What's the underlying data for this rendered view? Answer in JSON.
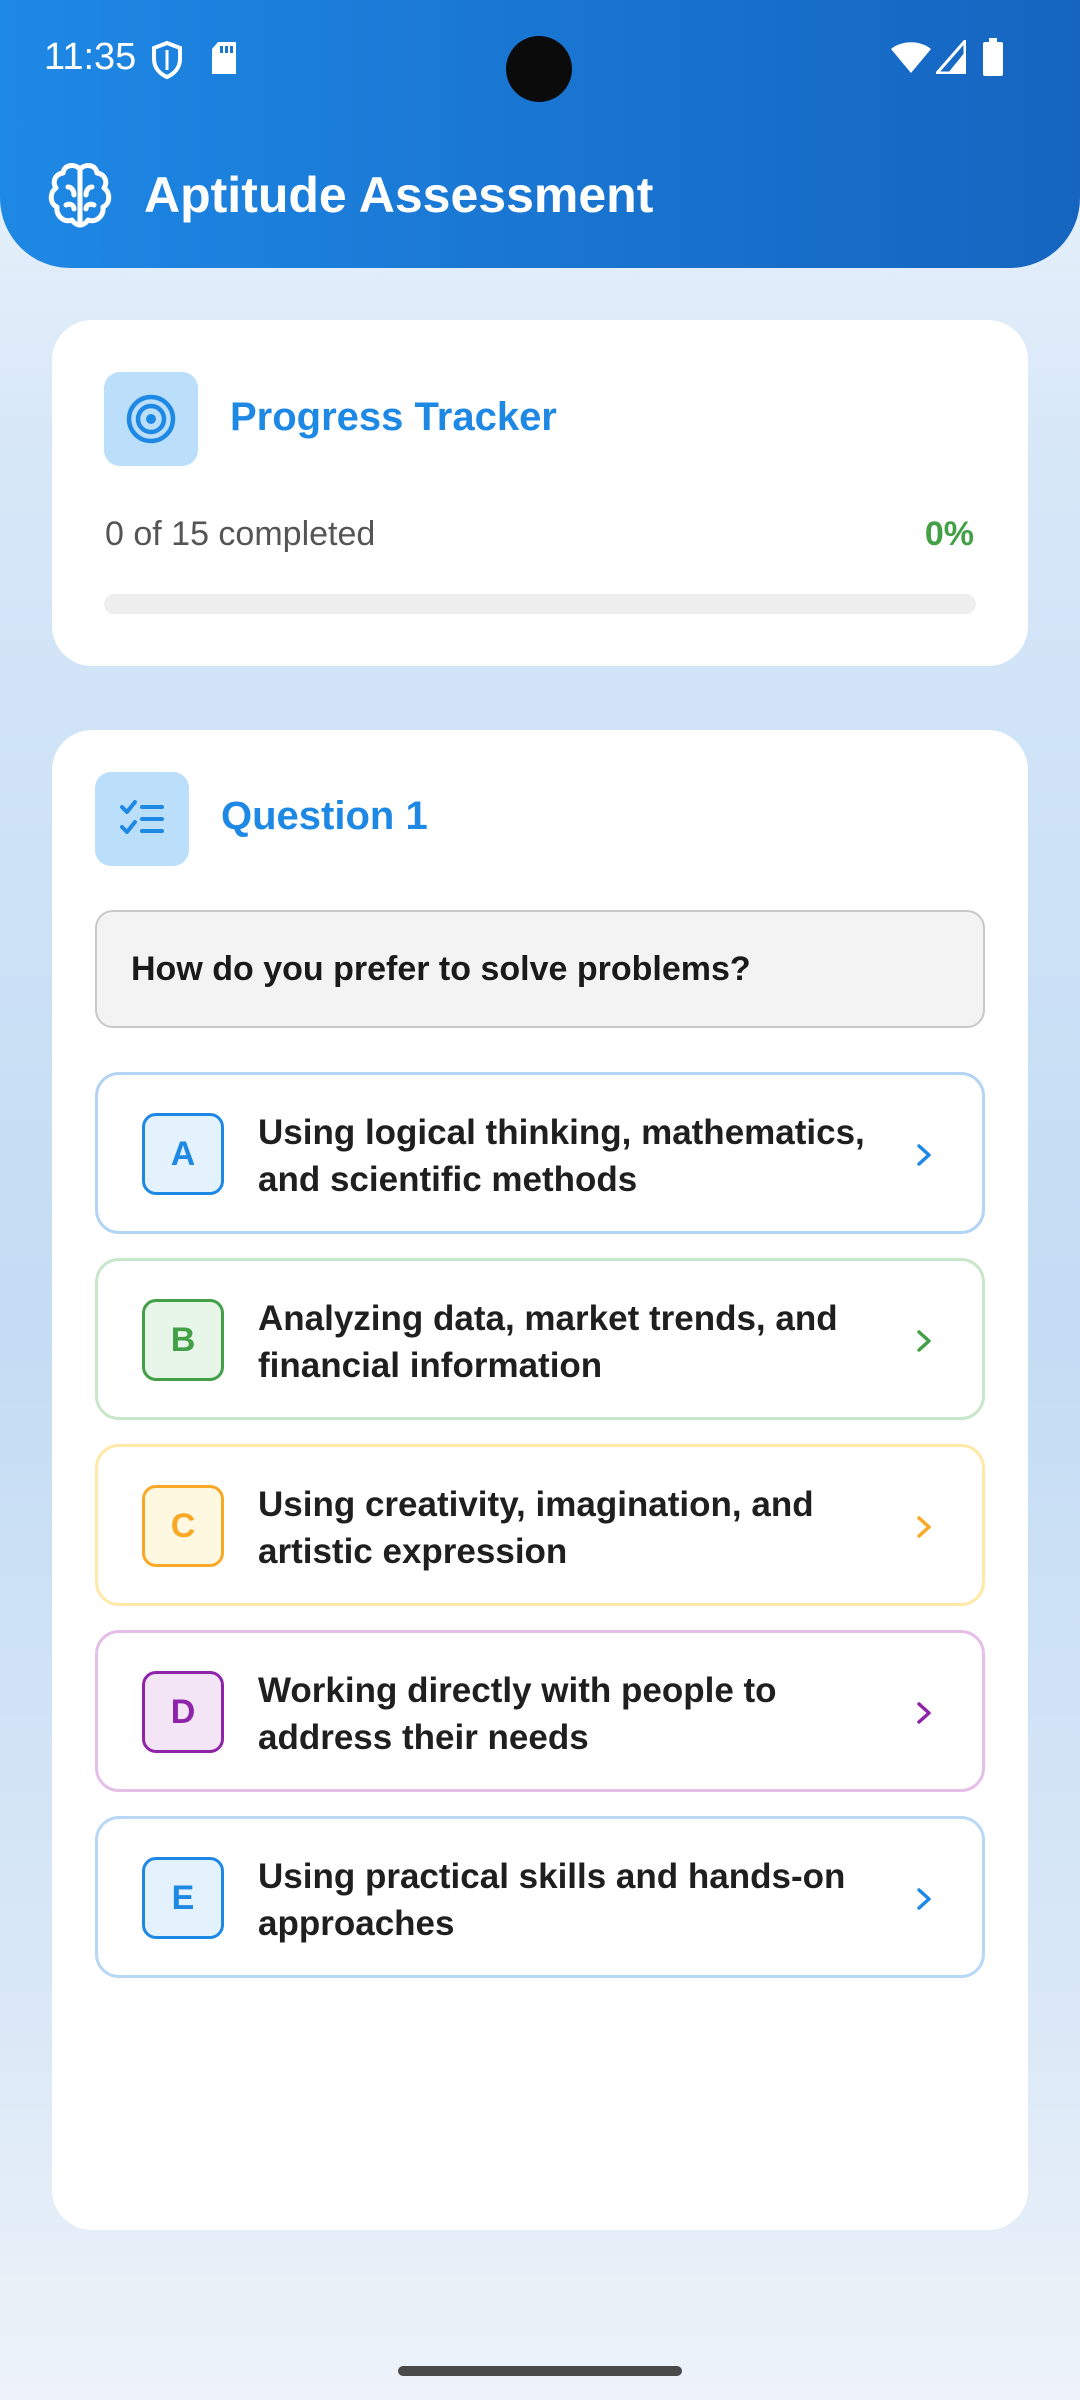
{
  "status_bar": {
    "time": "11:35"
  },
  "app_bar": {
    "title": "Aptitude Assessment"
  },
  "progress": {
    "title": "Progress Tracker",
    "summary": "0 of 15 completed",
    "percent_label": "0%",
    "fraction": 0
  },
  "question": {
    "title": "Question 1",
    "prompt": "How do you prefer to solve problems?",
    "options": [
      {
        "letter": "A",
        "text": "Using logical thinking, mathematics, and scientific methods",
        "color": "#1e88e5",
        "border": "#b3d4f5",
        "badge_bg": "#e3f2fd"
      },
      {
        "letter": "B",
        "text": "Analyzing data, market trends, and financial information",
        "color": "#43a047",
        "border": "#c8e6c9",
        "badge_bg": "#e8f5e9"
      },
      {
        "letter": "C",
        "text": "Using creativity, imagination, and artistic expression",
        "color": "#f9a825",
        "border": "#ffe8a8",
        "badge_bg": "#fff8e1"
      },
      {
        "letter": "D",
        "text": "Working directly with people to address their needs",
        "color": "#8e24aa",
        "border": "#e6bfe9",
        "badge_bg": "#f3e5f5"
      },
      {
        "letter": "E",
        "text": "Using practical skills and hands-on approaches",
        "color": "#1e88e5",
        "border": "#b8d8f6",
        "badge_bg": "#e3f2fd"
      }
    ]
  }
}
